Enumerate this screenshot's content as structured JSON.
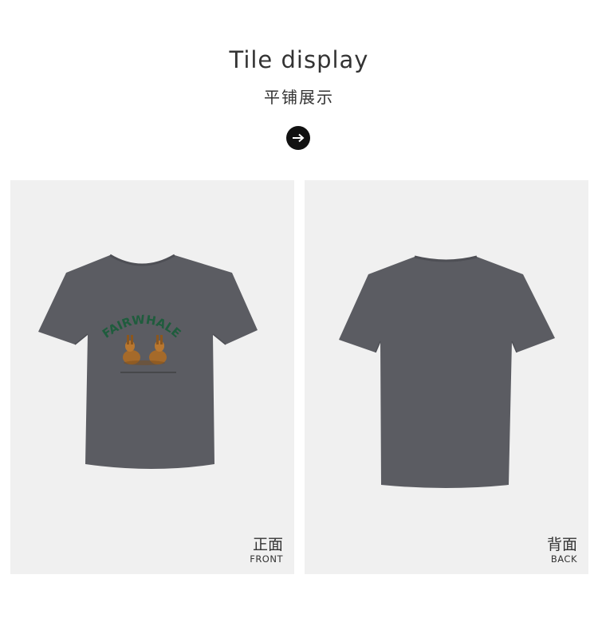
{
  "header": {
    "title_en": "Tile display",
    "title_cn": "平铺展示",
    "arrow_icon": "arrow-right-icon"
  },
  "front": {
    "label_cn": "正面",
    "label_en": "FRONT",
    "print_text": "FAIRWHALE"
  },
  "back": {
    "label_cn": "背面",
    "label_en": "BACK"
  },
  "colors": {
    "shirt": "#5b5c62",
    "panel_bg": "#f0f0f0",
    "print_green": "#1f5c3d"
  }
}
